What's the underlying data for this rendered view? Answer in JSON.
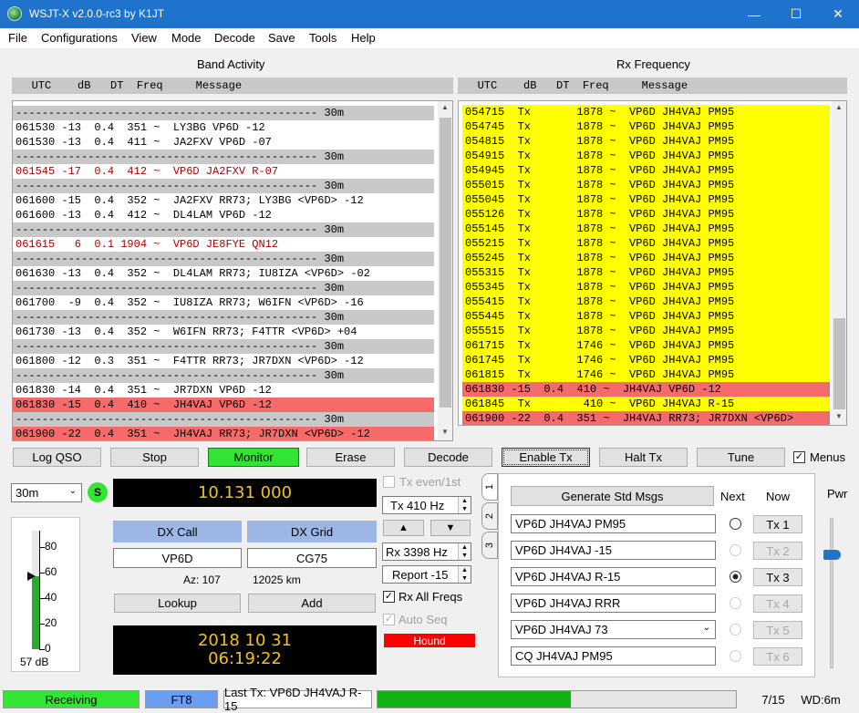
{
  "window": {
    "title": "WSJT-X   v2.0.0-rc3   by K1JT"
  },
  "menu": [
    "File",
    "Configurations",
    "View",
    "Mode",
    "Decode",
    "Save",
    "Tools",
    "Help"
  ],
  "band_activity": {
    "caption": "Band Activity",
    "header": "   UTC    dB   DT  Freq     Message",
    "rows": [
      {
        "t": "---------------------------------------------- 30m",
        "k": "sep"
      },
      {
        "t": "061530 -13  0.4  351 ~  LY3BG VP6D -12",
        "k": ""
      },
      {
        "t": "061530 -13  0.4  411 ~  JA2FXV VP6D -07",
        "k": ""
      },
      {
        "t": "---------------------------------------------- 30m",
        "k": "sep"
      },
      {
        "t": "061545 -17  0.4  412 ~  VP6D JA2FXV R-07",
        "k": "red"
      },
      {
        "t": "---------------------------------------------- 30m",
        "k": "sep"
      },
      {
        "t": "061600 -15  0.4  352 ~  JA2FXV RR73; LY3BG <VP6D> -12",
        "k": ""
      },
      {
        "t": "061600 -13  0.4  412 ~  DL4LAM VP6D -12",
        "k": ""
      },
      {
        "t": "---------------------------------------------- 30m",
        "k": "sep"
      },
      {
        "t": "061615   6  0.1 1904 ~  VP6D JE8FYE QN12",
        "k": "red"
      },
      {
        "t": "---------------------------------------------- 30m",
        "k": "sep"
      },
      {
        "t": "061630 -13  0.4  352 ~  DL4LAM RR73; IU8IZA <VP6D> -02",
        "k": ""
      },
      {
        "t": "---------------------------------------------- 30m",
        "k": "sep"
      },
      {
        "t": "061700  -9  0.4  352 ~  IU8IZA RR73; W6IFN <VP6D> -16",
        "k": ""
      },
      {
        "t": "---------------------------------------------- 30m",
        "k": "sep"
      },
      {
        "t": "061730 -13  0.4  352 ~  W6IFN RR73; F4TTR <VP6D> +04",
        "k": ""
      },
      {
        "t": "---------------------------------------------- 30m",
        "k": "sep"
      },
      {
        "t": "061800 -12  0.3  351 ~  F4TTR RR73; JR7DXN <VP6D> -12",
        "k": ""
      },
      {
        "t": "---------------------------------------------- 30m",
        "k": "sep"
      },
      {
        "t": "061830 -14  0.4  351 ~  JR7DXN VP6D -12",
        "k": ""
      },
      {
        "t": "061830 -15  0.4  410 ~  JH4VAJ VP6D -12",
        "k": "hl"
      },
      {
        "t": "---------------------------------------------- 30m",
        "k": "sep"
      },
      {
        "t": "061900 -22  0.4  351 ~  JH4VAJ RR73; JR7DXN <VP6D> -12",
        "k": "hl"
      }
    ]
  },
  "rx_frequency": {
    "caption": "Rx Frequency",
    "header": "   UTC    dB   DT  Freq     Message",
    "rows": [
      {
        "t": "054715  Tx       1878 ~  VP6D JH4VAJ PM95",
        "k": "yl"
      },
      {
        "t": "054745  Tx       1878 ~  VP6D JH4VAJ PM95",
        "k": "yl"
      },
      {
        "t": "054815  Tx       1878 ~  VP6D JH4VAJ PM95",
        "k": "yl"
      },
      {
        "t": "054915  Tx       1878 ~  VP6D JH4VAJ PM95",
        "k": "yl"
      },
      {
        "t": "054945  Tx       1878 ~  VP6D JH4VAJ PM95",
        "k": "yl"
      },
      {
        "t": "055015  Tx       1878 ~  VP6D JH4VAJ PM95",
        "k": "yl"
      },
      {
        "t": "055045  Tx       1878 ~  VP6D JH4VAJ PM95",
        "k": "yl"
      },
      {
        "t": "055126  Tx       1878 ~  VP6D JH4VAJ PM95",
        "k": "yl"
      },
      {
        "t": "055145  Tx       1878 ~  VP6D JH4VAJ PM95",
        "k": "yl"
      },
      {
        "t": "055215  Tx       1878 ~  VP6D JH4VAJ PM95",
        "k": "yl"
      },
      {
        "t": "055245  Tx       1878 ~  VP6D JH4VAJ PM95",
        "k": "yl"
      },
      {
        "t": "055315  Tx       1878 ~  VP6D JH4VAJ PM95",
        "k": "yl"
      },
      {
        "t": "055345  Tx       1878 ~  VP6D JH4VAJ PM95",
        "k": "yl"
      },
      {
        "t": "055415  Tx       1878 ~  VP6D JH4VAJ PM95",
        "k": "yl"
      },
      {
        "t": "055445  Tx       1878 ~  VP6D JH4VAJ PM95",
        "k": "yl"
      },
      {
        "t": "055515  Tx       1878 ~  VP6D JH4VAJ PM95",
        "k": "yl"
      },
      {
        "t": "061715  Tx       1746 ~  VP6D JH4VAJ PM95",
        "k": "yl"
      },
      {
        "t": "061745  Tx       1746 ~  VP6D JH4VAJ PM95",
        "k": "yl"
      },
      {
        "t": "061815  Tx       1746 ~  VP6D JH4VAJ PM95",
        "k": "yl"
      },
      {
        "t": "061830 -15  0.4  410 ~  JH4VAJ VP6D -12",
        "k": "hl"
      },
      {
        "t": "061845  Tx        410 ~  VP6D JH4VAJ R-15",
        "k": "yl"
      },
      {
        "t": "061900 -22  0.4  351 ~  JH4VAJ RR73; JR7DXN <VP6D>",
        "k": "hl"
      }
    ]
  },
  "buttons": {
    "log_qso": "Log QSO",
    "stop": "Stop",
    "monitor": "Monitor",
    "erase": "Erase",
    "decode": "Decode",
    "enable_tx": "Enable Tx",
    "halt_tx": "Halt Tx",
    "tune": "Tune",
    "menus": "Menus"
  },
  "band": {
    "selected": "30m",
    "s_indicator": "S"
  },
  "meter": {
    "ticks": [
      "80",
      "60",
      "40",
      "20",
      "0"
    ],
    "reading": "57 dB",
    "level_db": 57
  },
  "dial_frequency": "10.131 000",
  "dx": {
    "call_label": "DX Call",
    "grid_label": "DX Grid",
    "call": "VP6D",
    "grid": "CG75",
    "az": "Az: 107",
    "distance": "12025 km",
    "lookup": "Lookup",
    "add": "Add"
  },
  "clock": {
    "date": "2018 10 31",
    "time": "06:19:22"
  },
  "controls": {
    "tx_even": "Tx even/1st",
    "tx_freq": "Tx  410  Hz",
    "up_arrow": "▲",
    "down_arrow": "▼",
    "rx_freq": "Rx  3398  Hz",
    "report": "Report -15",
    "rx_all": "Rx All Freqs",
    "auto_seq": "Auto Seq",
    "hound": "Hound"
  },
  "tabs": [
    "1",
    "2",
    "3"
  ],
  "messages": {
    "generate": "Generate Std Msgs",
    "next": "Next",
    "now": "Now",
    "items": [
      {
        "text": "VP6D JH4VAJ PM95",
        "tx": "Tx 1"
      },
      {
        "text": "VP6D JH4VAJ -15",
        "tx": "Tx 2"
      },
      {
        "text": "VP6D JH4VAJ R-15",
        "tx": "Tx 3"
      },
      {
        "text": "VP6D JH4VAJ RRR",
        "tx": "Tx 4"
      },
      {
        "text": "VP6D JH4VAJ 73",
        "tx": "Tx 5"
      },
      {
        "text": "CQ JH4VAJ PM95",
        "tx": "Tx 6"
      }
    ]
  },
  "pwr": {
    "label": "Pwr"
  },
  "status": {
    "state": "Receiving",
    "mode": "FT8",
    "last_tx": "Last Tx: VP6D JH4VAJ R-15",
    "progress": 0.54,
    "seq": "7/15",
    "wd": "WD:6m"
  },
  "colors": {
    "yellow": "#ffff00",
    "red_highlight": "#f56b6b",
    "monitor_green": "#33e533",
    "status_green": "#33e533",
    "mode_blue": "#6b9df2",
    "hound_red": "#ff0000",
    "dx_blue": "#9db6e3"
  }
}
